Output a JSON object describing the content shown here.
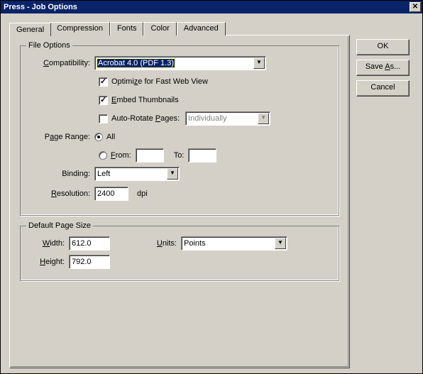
{
  "window": {
    "title": "Press - Job Options",
    "close_glyph": "✕"
  },
  "tabs": {
    "general": "General",
    "compression": "Compression",
    "fonts": "Fonts",
    "color": "Color",
    "advanced": "Advanced"
  },
  "buttons": {
    "ok": "OK",
    "save_as": "Save As...",
    "cancel": "Cancel"
  },
  "file_options": {
    "title": "File Options",
    "compatibility_label": "Compatibility:",
    "compatibility_value": "Acrobat 4.0 (PDF 1.3)",
    "optimize_label": "Optimize for Fast Web View",
    "optimize_checked": true,
    "embed_label": "Embed Thumbnails",
    "embed_checked": true,
    "autorotate_label": "Auto-Rotate Pages:",
    "autorotate_checked": false,
    "autorotate_value": "Individually",
    "page_range_label": "Page Range:",
    "pr_all": "All",
    "pr_from": "From:",
    "pr_to": "To:",
    "pr_from_value": "",
    "pr_to_value": "",
    "binding_label": "Binding:",
    "binding_value": "Left",
    "resolution_label": "Resolution:",
    "resolution_value": "2400",
    "resolution_unit": "dpi"
  },
  "default_page_size": {
    "title": "Default Page Size",
    "width_label": "Width:",
    "width_value": "612.0",
    "height_label": "Height:",
    "height_value": "792.0",
    "units_label": "Units:",
    "units_value": "Points"
  }
}
